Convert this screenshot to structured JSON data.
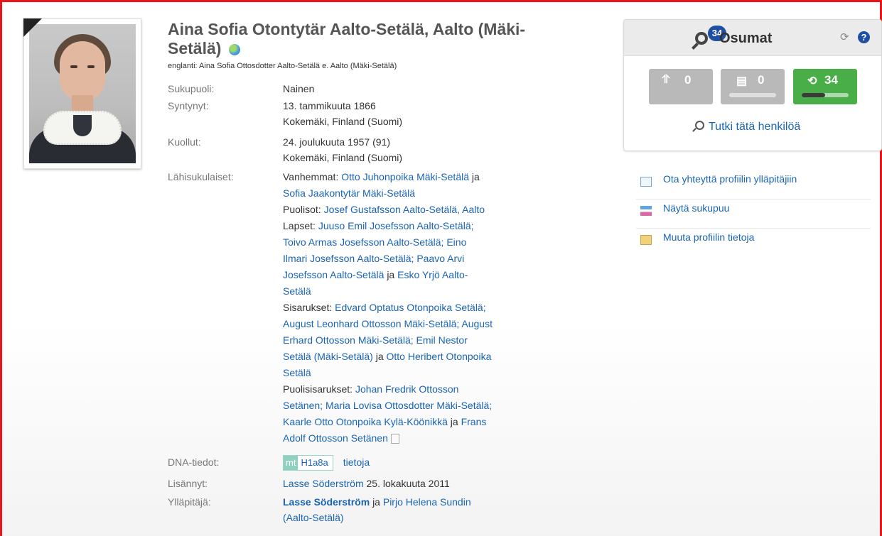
{
  "profile": {
    "name_line1": "Aina Sofia Otontytär Aalto-Setälä, Aalto (Mäki-",
    "name_line2": "Setälä)",
    "english_name": "englanti: Aina Sofia Ottosdotter Aalto-Setälä e. Aalto (Mäki-Setälä)",
    "globe_icon": "globe-icon"
  },
  "facts": {
    "gender_label": "Sukupuoli:",
    "gender_value": "Nainen",
    "born_label": "Syntynyt:",
    "born_date": "13. tammikuuta 1866",
    "born_place": "Kokemäki, Finland (Suomi)",
    "died_label": "Kuollut:",
    "died_date": "24. joulukuuta 1957 (91)",
    "died_place": "Kokemäki, Finland (Suomi)",
    "relatives_label": "Lähisukulaiset:"
  },
  "relatives": {
    "parents_label": "Vanhemmat:",
    "parent1": "Otto Juhonpoika Mäki-Setälä",
    "and": "ja",
    "parent2": "Sofia Jaakontytär Mäki-Setälä",
    "spouses_label": "Puolisot:",
    "spouse1": "Josef Gustafsson Aalto-Setälä, Aalto",
    "children_label": "Lapset:",
    "child1_a": "Juuso Emil Josefsson Aalto-Setälä;",
    "child2": "Toivo Armas Josefsson Aalto-Setälä;",
    "child3_a": "Eino",
    "child3_b": "Ilmari Josefsson Aalto-Setälä;",
    "child4_a": "Paavo Arvi",
    "child4_b": "Josefsson Aalto-Setälä",
    "child5_a": "Esko Yrjö Aalto-",
    "child5_b": "Setälä",
    "siblings_label": "Sisarukset:",
    "sib1": "Edvard Optatus Otonpoika Setälä;",
    "sib2": "August Leonhard Ottosson Mäki-Setälä;",
    "sib3_a": "August",
    "sib3_b": "Erhard Ottosson Mäki-Setälä;",
    "sib4_a": "Emil Nestor",
    "sib4_b": "Setälä (Mäki-Setälä)",
    "sib5_a": "Otto Heribert Otonpoika",
    "sib5_b": "Setälä",
    "half_label": "Puolisisarukset:",
    "half1_a": "Johan Fredrik Ottosson",
    "half1_b": "Setänen;",
    "half2": "Maria Lovisa Ottosdotter Mäki-Setälä;",
    "half3": "Kaarle Otto Otonpoika Kylä-Köönikkä",
    "half4_a": "Frans",
    "half4_b": "Adolf Ottosson Setänen"
  },
  "dna": {
    "label": "DNA-tiedot:",
    "mt": "mt",
    "haplogroup": "H1a8a",
    "info_link": "tietoja"
  },
  "added": {
    "label": "Lisännyt:",
    "by": "Lasse Söderström",
    "date": "25. lokakuuta 2011"
  },
  "managers": {
    "label": "Ylläpitäjä:",
    "manager1": "Lasse Söderström",
    "and": "ja",
    "manager2_a": "Pirjo Helena Sundin",
    "manager2_b": "(Aalto-Setälä)"
  },
  "matches": {
    "title": "Osumat",
    "count": "34",
    "btn1_count": "0",
    "btn2_count": "0",
    "btn3_count": "34",
    "btn3_progress": 0.5,
    "explore_link": "Tutki tätä henkilöä"
  },
  "side_links": [
    {
      "label": "Ota yhteyttä profiilin ylläpitäjiin",
      "icon": "envelope-icon"
    },
    {
      "label": "Näytä sukupuu",
      "icon": "family-tree-icon"
    },
    {
      "label": "Muuta profiilin tietoja",
      "icon": "edit-icon"
    }
  ],
  "colors": {
    "frame": "#e8151b",
    "link": "#1a64b4",
    "green": "#4aae48",
    "badge": "#1f4fa3"
  }
}
